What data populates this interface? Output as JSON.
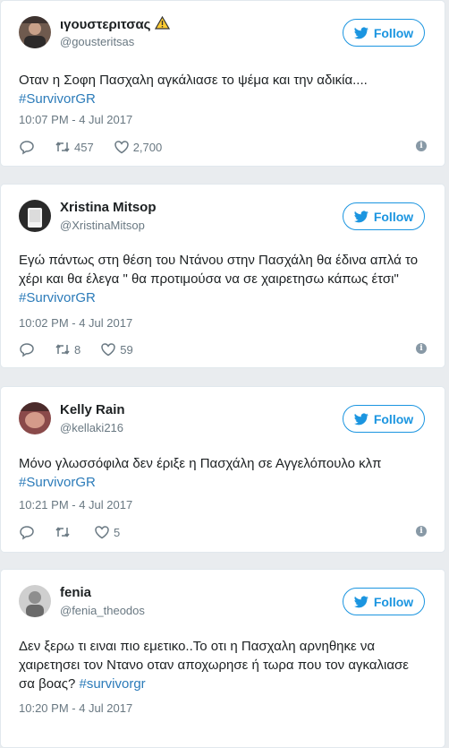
{
  "tweets": [
    {
      "name": "ιγουστεριτσας",
      "handle": "@gousteritsas",
      "follow_label": "Follow",
      "text": "Οταν η Σοφη Πασχαλη αγκάλιασε το ψέμα και την αδικία....",
      "hashtag": "#SurvivorGR",
      "time": "10:07 PM - 4 Jul 2017",
      "retweets": "457",
      "likes": "2,700"
    },
    {
      "name": "Xristina Mitsop",
      "handle": "@XristinaMitsop",
      "follow_label": "Follow",
      "text": "Εγώ πάντως στη θέση του Ντάνου στην Πασχάλη θα έδινα απλά το χέρι και θα έλεγα \" θα προτιμούσα να σε χαιρετησω κάπως έτσι\"",
      "hashtag": "#SurvivorGR",
      "time": "10:02 PM - 4 Jul 2017",
      "retweets": "8",
      "likes": "59"
    },
    {
      "name": "Kelly Rain",
      "handle": "@kellaki216",
      "follow_label": "Follow",
      "text": "Μόνο γλωσσόφιλα δεν έριξε η Πασχάλη σε Αγγελόπουλο κλπ",
      "hashtag": "#SurvivorGR",
      "time": "10:21 PM - 4 Jul 2017",
      "retweets": "",
      "likes": "5"
    },
    {
      "name": "fenia",
      "handle": "@fenia_theodos",
      "follow_label": "Follow",
      "text": "Δεν ξερω τι ειναι πιο εμετικο..Το οτι η Πασχαλη αρνηθηκε να χαιρετησει τον Ντανο οταν αποχωρησε ή τωρα που τον αγκαλιασε σα βοας?",
      "hashtag": "#survivorgr",
      "time": "10:20 PM - 4 Jul 2017"
    }
  ],
  "colors": {
    "accent": "#1b95e0",
    "link": "#2b7bb9",
    "muted": "#697882",
    "warning": "#ffcc33"
  },
  "icons": [
    "warning-icon",
    "twitter-bird-icon",
    "reply-icon",
    "retweet-icon",
    "like-icon",
    "info-icon"
  ]
}
